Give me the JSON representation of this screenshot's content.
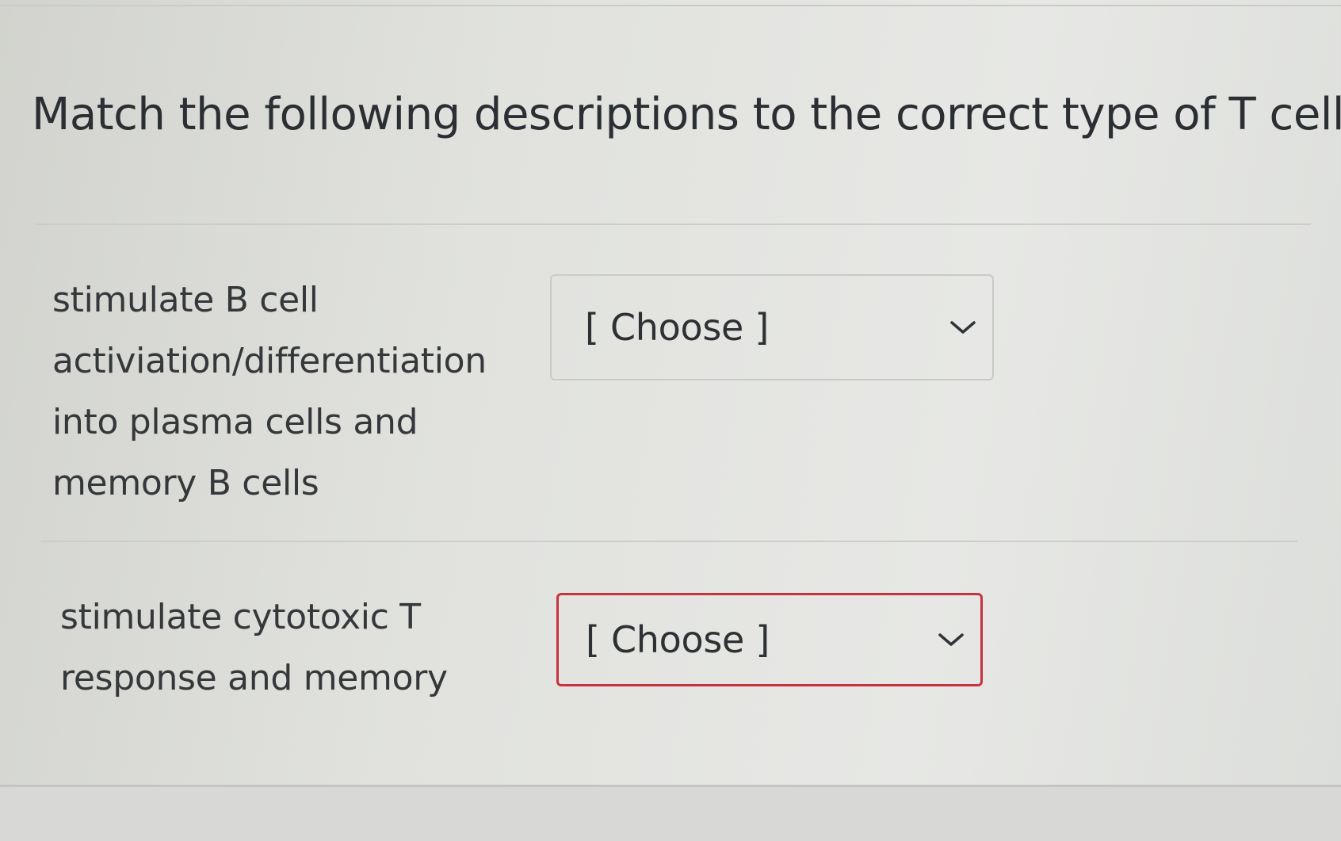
{
  "question": {
    "title": "Match the following descriptions to the correct type of T cell:"
  },
  "matches": [
    {
      "description_lines": [
        "stimulate B cell",
        "activiation/differentiation",
        "into plasma cells and",
        "memory B cells"
      ],
      "select_value": "[ Choose ]",
      "state": "default"
    },
    {
      "description_lines": [
        "stimulate cytotoxic T",
        "response and memory"
      ],
      "select_value": "[ Choose ]",
      "state": "error"
    }
  ],
  "colors": {
    "error_border": "#c8323e",
    "default_border": "#c9cbc7",
    "text": "#2f3336"
  },
  "icons": {
    "select_arrow": "chevron-down-icon"
  }
}
